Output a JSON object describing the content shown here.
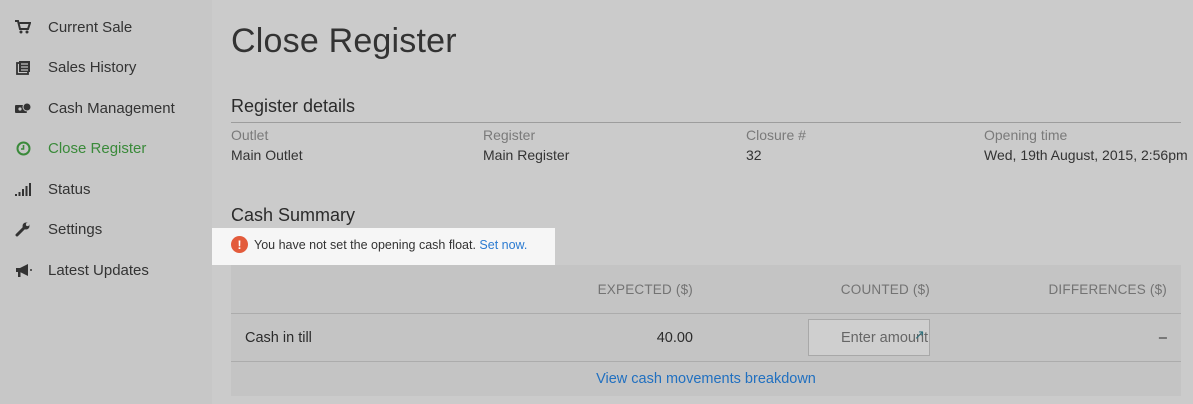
{
  "sidebar": {
    "items": [
      {
        "label": "Current Sale",
        "icon": "cart-icon"
      },
      {
        "label": "Sales History",
        "icon": "history-icon"
      },
      {
        "label": "Cash Management",
        "icon": "cash-icon"
      },
      {
        "label": "Close Register",
        "icon": "clock-icon",
        "active": true
      },
      {
        "label": "Status",
        "icon": "signal-bars-icon"
      },
      {
        "label": "Settings",
        "icon": "wrench-icon"
      },
      {
        "label": "Latest Updates",
        "icon": "megaphone-icon"
      }
    ],
    "active_color": "#3a8a3a"
  },
  "page": {
    "title": "Close Register"
  },
  "register_details": {
    "title": "Register details",
    "fields": [
      {
        "label": "Outlet",
        "value": "Main Outlet"
      },
      {
        "label": "Register",
        "value": "Main Register"
      },
      {
        "label": "Closure #",
        "value": "32"
      },
      {
        "label": "Opening time",
        "value": "Wed, 19th August, 2015, 2:56pm"
      }
    ]
  },
  "cash_summary": {
    "title": "Cash Summary",
    "alert": {
      "text": "You have not set the opening cash float.",
      "link": "Set now.",
      "icon": "exclamation-icon",
      "icon_color": "#e35b3b"
    },
    "headers": {
      "expected": "EXPECTED ($)",
      "counted": "COUNTED ($)",
      "differences": "DIFFERENCES ($)"
    },
    "rows": [
      {
        "label": "Cash in till",
        "expected": "40.00",
        "counted_placeholder": "Enter amount",
        "difference": "–"
      }
    ],
    "breakdown_link": "View cash movements breakdown",
    "link_color": "#2170c0"
  }
}
